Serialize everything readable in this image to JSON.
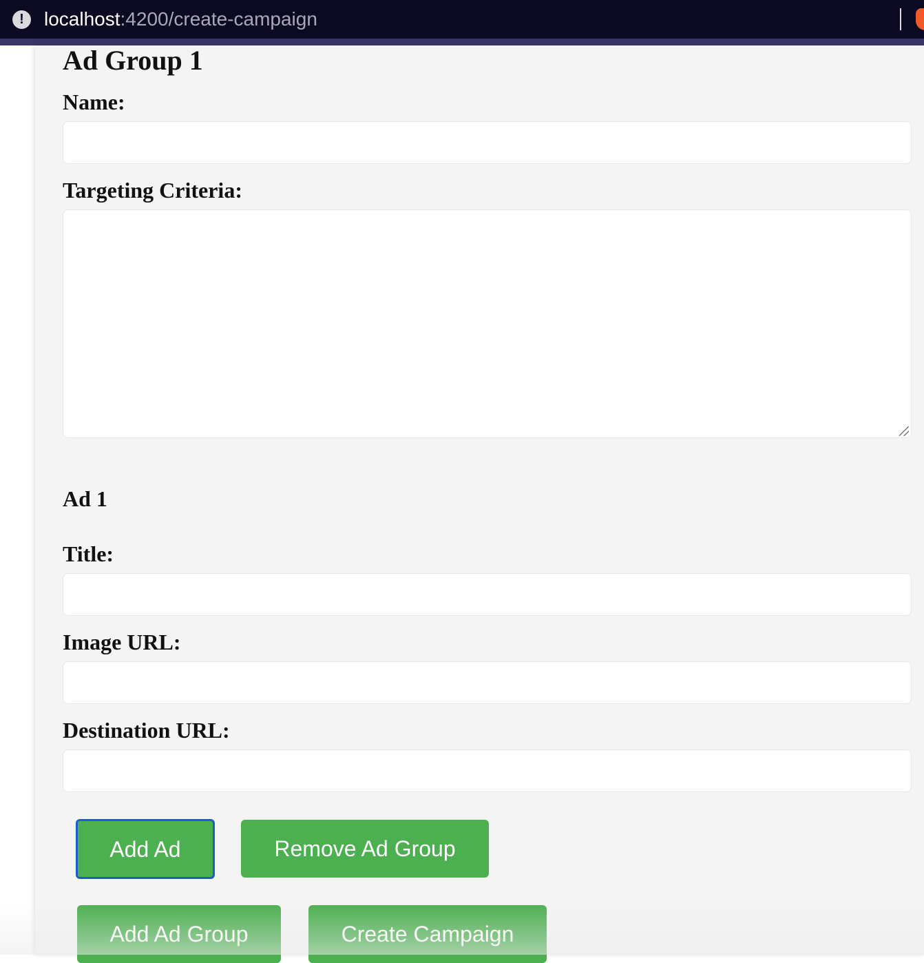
{
  "browser": {
    "url_host": "localhost",
    "url_path": ":4200/create-campaign",
    "info_icon": "info-icon",
    "extension_icon": "brave-shield-icon"
  },
  "ad_group": {
    "heading": "Ad Group 1",
    "name_label": "Name:",
    "name_value": "",
    "targeting_label": "Targeting Criteria:",
    "targeting_value": ""
  },
  "ad": {
    "heading": "Ad 1",
    "title_label": "Title:",
    "title_value": "",
    "image_url_label": "Image URL:",
    "image_url_value": "",
    "destination_url_label": "Destination URL:",
    "destination_url_value": ""
  },
  "buttons": {
    "add_ad": "Add Ad",
    "remove_ad_group": "Remove Ad Group",
    "add_ad_group": "Add Ad Group",
    "create_campaign": "Create Campaign"
  },
  "colors": {
    "button_green": "#4caf50",
    "focus_ring": "#1a5fc7",
    "browser_bar": "#0b0a22",
    "panel_bg": "#f4f4f4"
  }
}
